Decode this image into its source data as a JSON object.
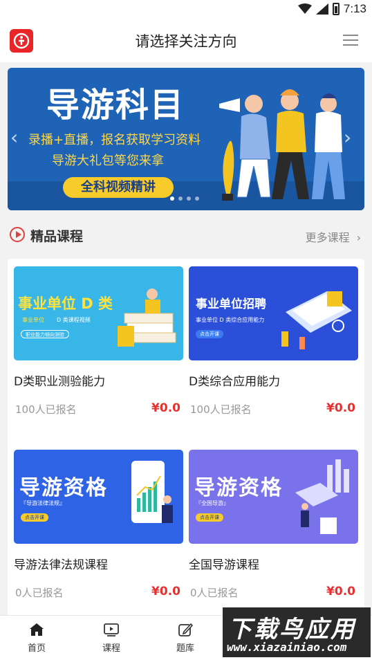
{
  "status_bar": {
    "time": "7:13"
  },
  "header": {
    "title": "请选择关注方向"
  },
  "banner": {
    "title": "导游科目",
    "line1": "录播+直播，报名获取学习资料",
    "line2": "导游大礼包等您来拿",
    "pill": "全科视频精讲",
    "page_count": 4,
    "active_page": 1
  },
  "section": {
    "title": "精品课程",
    "more_label": "更多课程"
  },
  "courses": [
    {
      "name": "D类职业测验能力",
      "count": "100人已报名",
      "price": "¥0.0",
      "thumb_title": "事业单位 D 类",
      "thumb_sub1": "事业单位",
      "thumb_sub2": "D 类课程视频",
      "thumb_pill": "职业能力倾向测验",
      "bg": "#38b6e8"
    },
    {
      "name": "D类综合应用能力",
      "count": "100人已报名",
      "price": "¥0.0",
      "thumb_title": "事业单位招聘",
      "thumb_sub1": "事业单位 D 类综合应用能力",
      "thumb_pill": "点击开课",
      "bg": "#2b4fd8"
    },
    {
      "name": "导游法律法规课程",
      "count": "0人已报名",
      "price": "¥0.0",
      "thumb_title": "导游资格",
      "thumb_sub1": "『导游法律法规』",
      "thumb_pill": "点击开课",
      "bg": "#2f63e6"
    },
    {
      "name": "全国导游课程",
      "count": "0人已报名",
      "price": "¥0.0",
      "thumb_title": "导游资格",
      "thumb_sub1": "『全国导游』",
      "thumb_pill": "点击开课",
      "bg": "#7a72ea"
    }
  ],
  "bottom_nav": [
    {
      "label": "首页",
      "icon": "home-icon"
    },
    {
      "label": "课程",
      "icon": "video-icon"
    },
    {
      "label": "题库",
      "icon": "edit-icon"
    }
  ],
  "watermark": {
    "top": "下载鸟应用",
    "bottom": "www.xiazainiao.com"
  },
  "colors": {
    "accent": "#e8302e",
    "banner_bg": "#1f63b6",
    "banner_yellow": "#ffd84a"
  }
}
